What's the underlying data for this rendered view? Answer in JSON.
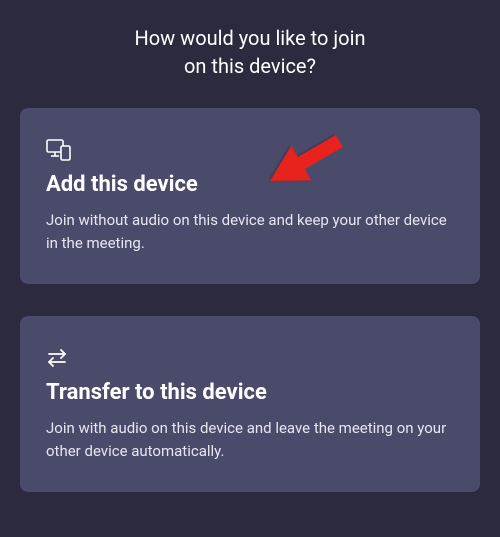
{
  "header": {
    "line1": "How would you like to join",
    "line2": "on this device?"
  },
  "cards": {
    "add": {
      "title": "Add this device",
      "description": "Join without audio on this device and keep your other device in the meeting."
    },
    "transfer": {
      "title": "Transfer to this device",
      "description": "Join with audio on this device and leave the meeting on your other device automatically."
    }
  }
}
